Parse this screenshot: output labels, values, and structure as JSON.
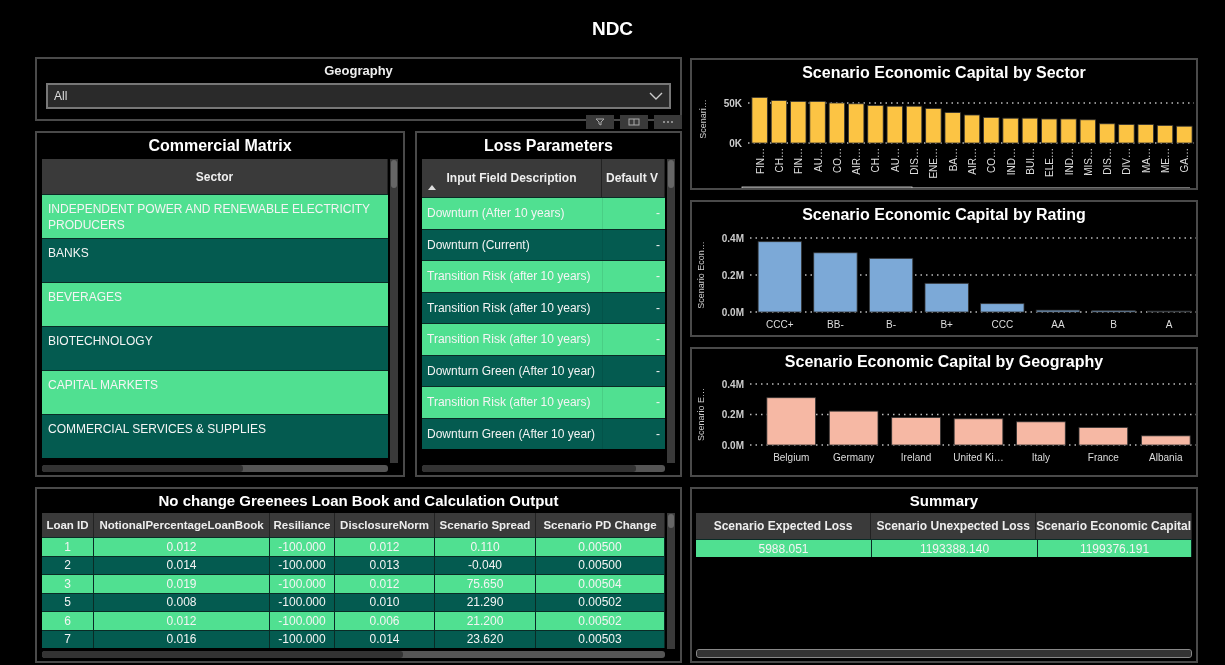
{
  "title": "NDC",
  "geography_slicer": {
    "label": "Geography",
    "value": "All"
  },
  "commercial_matrix": {
    "title": "Commercial Matrix",
    "columns": [
      "Sector"
    ],
    "rows": [
      [
        "INDEPENDENT POWER AND RENEWABLE ELECTRICITY PRODUCERS"
      ],
      [
        "BANKS"
      ],
      [
        "BEVERAGES"
      ],
      [
        "BIOTECHNOLOGY"
      ],
      [
        "CAPITAL MARKETS"
      ],
      [
        "COMMERCIAL SERVICES & SUPPLIES"
      ]
    ]
  },
  "loss_parameters": {
    "title": "Loss Parameters",
    "columns": [
      {
        "label": "Input Field Description",
        "sorted_ascending": true
      },
      {
        "label": "Default V",
        "sorted_ascending": false
      }
    ],
    "rows": [
      [
        "Downturn (After 10 years)",
        "-"
      ],
      [
        "Downturn (Current)",
        "-"
      ],
      [
        "Transition Risk (after 10 years)",
        "-"
      ],
      [
        "Transition Risk (after 10 years)",
        "-"
      ],
      [
        "Transition Risk (after 10 years)",
        "-"
      ],
      [
        "Downturn Green (After 10 year)",
        "-"
      ],
      [
        "Transition Risk (after 10 years)",
        "-"
      ],
      [
        "Downturn Green (After 10 year)",
        "-"
      ]
    ]
  },
  "loan_book": {
    "title": "No change Greenees Loan Book and Calculation Output",
    "columns": [
      "Loan ID",
      "NotionalPercentageLoanBook",
      "Resiliance",
      "DisclosureNorm",
      "Scenario Spread",
      "Scenario PD Change"
    ],
    "rows": [
      [
        "1",
        "0.012",
        "-100.000",
        "0.012",
        "0.110",
        "0.00500"
      ],
      [
        "2",
        "0.014",
        "-100.000",
        "0.013",
        "-0.040",
        "0.00500"
      ],
      [
        "3",
        "0.019",
        "-100.000",
        "0.012",
        "75.650",
        "0.00504"
      ],
      [
        "5",
        "0.008",
        "-100.000",
        "0.010",
        "21.290",
        "0.00502"
      ],
      [
        "6",
        "0.012",
        "-100.000",
        "0.006",
        "21.200",
        "0.00502"
      ],
      [
        "7",
        "0.016",
        "-100.000",
        "0.014",
        "23.620",
        "0.00503"
      ]
    ]
  },
  "charts": [
    {
      "title": "Scenario Economic Capital by Sector",
      "chart_data": {
        "type": "bar",
        "ylabel": "Scenari…",
        "categories": [
          "FIN…",
          "CH…",
          "FIN…",
          "AU…",
          "CO…",
          "AIR…",
          "CH…",
          "AU…",
          "DIS…",
          "ENE…",
          "BA…",
          "AIR…",
          "CO…",
          "IND…",
          "BUI…",
          "ELE…",
          "IND…",
          "MIS…",
          "DIS…",
          "DIV…",
          "MA…",
          "ME…",
          "GA…"
        ],
        "series": [
          {
            "color": "#fcc444",
            "values": [
              57000,
              53000,
              52000,
              52000,
              50000,
              49000,
              47000,
              46000,
              46000,
              43000,
              38000,
              35000,
              32000,
              31000,
              31000,
              30000,
              30000,
              29000,
              24000,
              23000,
              23000,
              22000,
              21000
            ]
          }
        ],
        "ylim": [
          0,
          60000
        ],
        "yticks": [
          {
            "value": 0,
            "label": "0K"
          },
          {
            "value": 50000,
            "label": "50K"
          }
        ]
      }
    },
    {
      "title": "Scenario Economic Capital by Rating",
      "chart_data": {
        "type": "bar",
        "ylabel": "Scenario Econ…",
        "categories": [
          "CCC+",
          "BB-",
          "B-",
          "B+",
          "CCC",
          "AA",
          "B",
          "A"
        ],
        "series": [
          {
            "color": "#7ca9d7",
            "values": [
              380000,
              320000,
              290000,
              155000,
              45000,
              10000,
              7000,
              5000
            ]
          }
        ],
        "ylim": [
          0,
          400000
        ],
        "yticks": [
          {
            "value": 0,
            "label": "0.0M"
          },
          {
            "value": 200000,
            "label": "0.2M"
          },
          {
            "value": 400000,
            "label": "0.4M"
          }
        ]
      }
    },
    {
      "title": "Scenario Economic Capital by Geography",
      "chart_data": {
        "type": "bar",
        "ylabel": "Scenario E…",
        "categories": [
          "Belgium",
          "Germany",
          "Ireland",
          "United Ki…",
          "Italy",
          "France",
          "Albania"
        ],
        "series": [
          {
            "color": "#f6b8a4",
            "values": [
              310000,
              222000,
              180000,
              172000,
              152000,
              115000,
              60000
            ]
          }
        ],
        "ylim": [
          0,
          400000
        ],
        "yticks": [
          {
            "value": 0,
            "label": "0.0M"
          },
          {
            "value": 200000,
            "label": "0.2M"
          },
          {
            "value": 400000,
            "label": "0.4M"
          }
        ]
      }
    }
  ],
  "summary": {
    "title": "Summary",
    "columns": [
      "Scenario Expected Loss",
      "Scenario Unexpected Loss",
      "Scenario Economic Capital"
    ],
    "rows": [
      [
        "5988.051",
        "1193388.140",
        "1199376.191"
      ]
    ]
  }
}
